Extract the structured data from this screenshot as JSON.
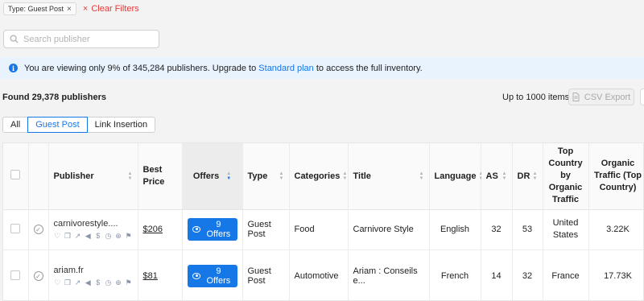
{
  "filters": {
    "chip_label": "Type: Guest Post",
    "chip_remove": "×",
    "clear_icon": "×",
    "clear_label": "Clear Filters"
  },
  "search": {
    "placeholder": "Search publisher"
  },
  "banner": {
    "text_before": "You are viewing only 9% of 345,284 publishers. Upgrade to ",
    "link": "Standard plan",
    "text_after": " to access the full inventory."
  },
  "results": {
    "found": "Found 29,378 publishers",
    "limit": "Up to 1000 items",
    "csv_label": "CSV Export"
  },
  "tabs": [
    {
      "label": "All",
      "active": false
    },
    {
      "label": "Guest Post",
      "active": true
    },
    {
      "label": "Link Insertion",
      "active": false
    }
  ],
  "columns": {
    "publisher": "Publisher",
    "best_price": "Best Price",
    "offers": "Offers",
    "type": "Type",
    "categories": "Categories",
    "title": "Title",
    "language": "Language",
    "as": "AS",
    "dr": "DR",
    "top_country": "Top Country by Organic Traffic",
    "organic_traffic": "Organic Traffic (Top Country)"
  },
  "rows": [
    {
      "publisher": "carnivorestyle....",
      "best_price": "$206",
      "offers": "9 Offers",
      "type": "Guest Post",
      "categories": "Food",
      "title": "Carnivore Style",
      "language": "English",
      "as": "32",
      "dr": "53",
      "top_country": "United States",
      "organic_traffic": "3.22K"
    },
    {
      "publisher": "ariam.fr",
      "best_price": "$81",
      "offers": "9 Offers",
      "type": "Guest Post",
      "categories": "Automotive",
      "title": "Ariam : Conseils e...",
      "language": "French",
      "as": "14",
      "dr": "32",
      "top_country": "France",
      "organic_traffic": "17.73K"
    }
  ],
  "icons": {
    "publisher_actions": [
      "heart-icon",
      "copy-icon",
      "external-link-icon",
      "megaphone-icon",
      "dollar-icon",
      "clock-icon",
      "plus-icon",
      "flag-icon"
    ]
  },
  "colors": {
    "accent": "#1677e6",
    "danger": "#e23b3b",
    "banner_bg": "#e8f3fd"
  }
}
